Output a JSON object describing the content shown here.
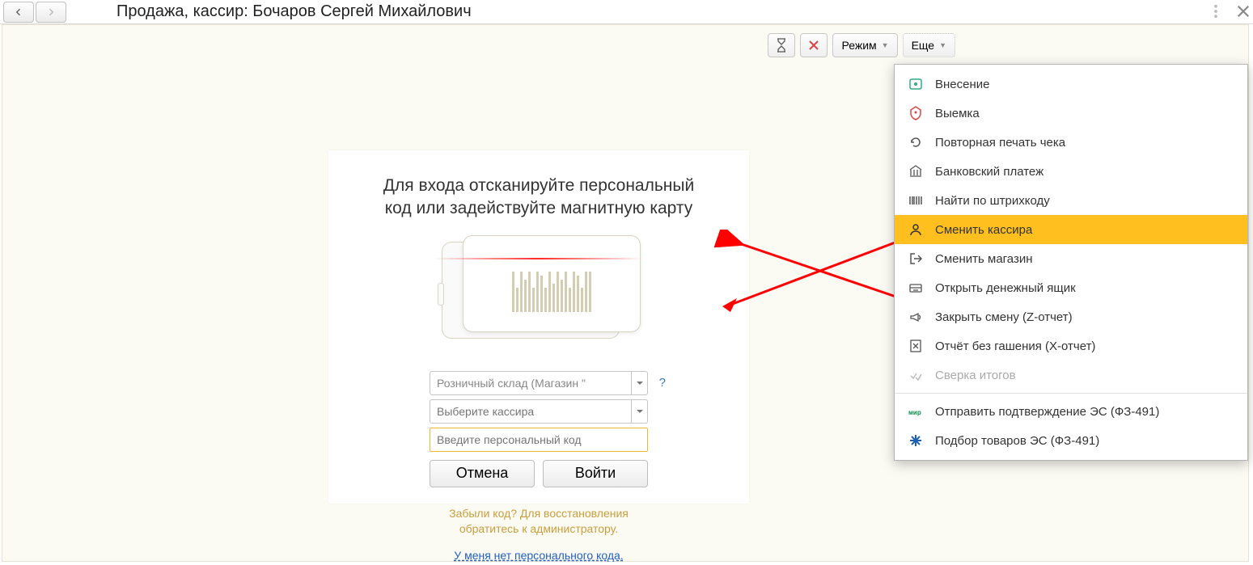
{
  "header": {
    "title": "Продажа, кассир: Бочаров Сергей Михайлович"
  },
  "toolbar": {
    "mode_label": "Режим",
    "more_label": "Еще"
  },
  "login": {
    "heading_line1": "Для входа отсканируйте персональный",
    "heading_line2": "код или задействуйте магнитную карту",
    "warehouse_value": "Розничный склад (Магазин \"",
    "cashier_placeholder": "Выберите кассира",
    "code_placeholder": "Введите персональный код",
    "cancel_label": "Отмена",
    "login_label": "Войти",
    "forgot_line1": "Забыли код? Для восстановления",
    "forgot_line2": "обратитесь к администратору.",
    "no_code_label": "У меня нет персонального кода."
  },
  "menu": {
    "items": [
      {
        "label": "Внесение",
        "icon": "deposit"
      },
      {
        "label": "Выемка",
        "icon": "withdraw"
      },
      {
        "label": "Повторная печать чека",
        "icon": "reprint"
      },
      {
        "label": "Банковский платеж",
        "icon": "bank"
      },
      {
        "label": "Найти по штрихкоду",
        "icon": "barcode"
      },
      {
        "label": "Сменить кассира",
        "icon": "user",
        "selected": true
      },
      {
        "label": "Сменить магазин",
        "icon": "exit"
      },
      {
        "label": "Открыть денежный ящик",
        "icon": "drawer"
      },
      {
        "label": "Закрыть смену (Z-отчет)",
        "icon": "horn"
      },
      {
        "label": "Отчёт без гашения (X-отчет)",
        "icon": "xreport"
      },
      {
        "label": "Сверка итогов",
        "icon": "check",
        "disabled": true
      },
      {
        "divider": true
      },
      {
        "label": "Отправить подтверждение ЭС (ФЗ-491)",
        "icon": "mir"
      },
      {
        "label": "Подбор товаров ЭС (ФЗ-491)",
        "icon": "star"
      }
    ]
  }
}
